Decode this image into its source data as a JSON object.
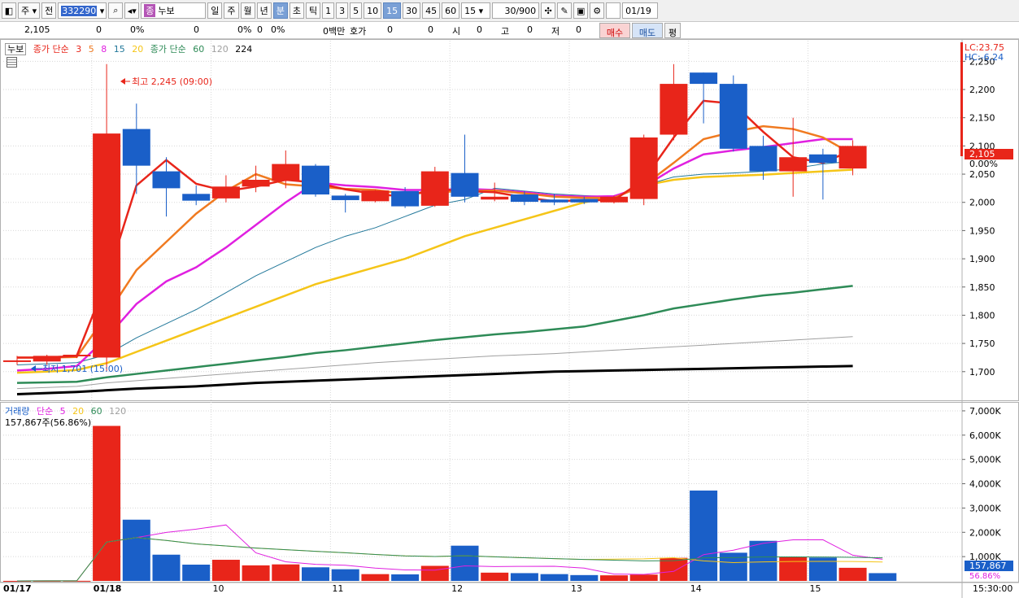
{
  "toolbar": {
    "market": "주",
    "prev": "전",
    "code": "332290",
    "name_badge": "종",
    "name": "누보",
    "periods": [
      "일",
      "주",
      "월",
      "년",
      "분",
      "초",
      "틱"
    ],
    "selected_period": "분",
    "intervals": [
      "1",
      "3",
      "5",
      "10",
      "15",
      "30",
      "45",
      "60"
    ],
    "selected_interval": "15",
    "interval_value": "15",
    "count": "30/900",
    "date": "01/19"
  },
  "quote": {
    "price": "2,105",
    "change": "0",
    "rate": "0%",
    "v1": "0",
    "v2": "0%",
    "v3": "0",
    "v4": "0%",
    "amount": "0백만",
    "hoga_label": "호가",
    "hoga1": "0",
    "hoga2": "0",
    "si_label": "시",
    "si": "0",
    "go_label": "고",
    "go": "0",
    "jeo_label": "저",
    "jeo": "0",
    "buy": "매수",
    "sell": "매도",
    "avg": "평"
  },
  "price_panel": {
    "name": "누보",
    "legend1": "종가 단순",
    "ma_short": [
      "3",
      "5",
      "8",
      "15",
      "20"
    ],
    "legend2": "종가 단순",
    "ma_long": [
      "60",
      "120",
      "224"
    ],
    "lc": "LC:23.75",
    "hc": "HC:-6.24",
    "high_label": "최고 2,245 (09:00)",
    "low_label": "최저 1,701 (15:00)",
    "current_price_tag": "2,105",
    "zero_pct": "0.00%"
  },
  "volume_panel": {
    "legend": "거래량",
    "legend2": "단순",
    "ma": [
      "5",
      "20",
      "60",
      "120"
    ],
    "info": "157,867주(56.86%)",
    "current_tag": "157,867",
    "pct_tag": "56.86%"
  },
  "x_axis": {
    "labels": [
      "01/17",
      "01/18",
      "10",
      "11",
      "12",
      "13",
      "14",
      "15"
    ],
    "end_time": "15:30:00"
  },
  "colors": {
    "up": "#e8251a",
    "down": "#1a5fc8",
    "ma3": "#e8251a",
    "ma5": "#f07a20",
    "ma8": "#e020e0",
    "ma15": "#22789a",
    "ma20": "#f5c518",
    "ma60": "#2e8b57",
    "ma120": "#a0a0a0",
    "ma224": "#000000"
  },
  "chart_data": {
    "type": "candlestick",
    "price_axis": [
      2250,
      2200,
      2150,
      2100,
      2050,
      2000,
      1950,
      1900,
      1850,
      1800,
      1750,
      1700
    ],
    "volume_axis": [
      "7,000K",
      "6,000K",
      "5,000K",
      "4,000K",
      "3,000K",
      "2,000K",
      "1,000K"
    ],
    "candles": [
      {
        "o": 1720,
        "h": 1728,
        "l": 1712,
        "c": 1720
      },
      {
        "o": 1718,
        "h": 1730,
        "l": 1712,
        "c": 1728
      },
      {
        "o": 1728,
        "h": 1732,
        "l": 1724,
        "c": 1730
      },
      {
        "o": 1725,
        "h": 2245,
        "l": 1701,
        "c": 2122
      },
      {
        "o": 2130,
        "h": 2175,
        "l": 2015,
        "c": 2065
      },
      {
        "o": 2055,
        "h": 2080,
        "l": 1975,
        "c": 2025
      },
      {
        "o": 2015,
        "h": 2030,
        "l": 1995,
        "c": 2003
      },
      {
        "o": 2007,
        "h": 2048,
        "l": 2000,
        "c": 2028
      },
      {
        "o": 2028,
        "h": 2065,
        "l": 2018,
        "c": 2040
      },
      {
        "o": 2038,
        "h": 2092,
        "l": 2025,
        "c": 2068
      },
      {
        "o": 2065,
        "h": 2068,
        "l": 2010,
        "c": 2014
      },
      {
        "o": 2012,
        "h": 2015,
        "l": 1982,
        "c": 2004
      },
      {
        "o": 2002,
        "h": 2022,
        "l": 2000,
        "c": 2021
      },
      {
        "o": 2020,
        "h": 2027,
        "l": 1990,
        "c": 1993
      },
      {
        "o": 1994,
        "h": 2063,
        "l": 1992,
        "c": 2055
      },
      {
        "o": 2052,
        "h": 2120,
        "l": 2000,
        "c": 2010
      },
      {
        "o": 2005,
        "h": 2035,
        "l": 2002,
        "c": 2010
      },
      {
        "o": 2014,
        "h": 2020,
        "l": 1995,
        "c": 2001
      },
      {
        "o": 2005,
        "h": 2015,
        "l": 1995,
        "c": 2000
      },
      {
        "o": 2006,
        "h": 2010,
        "l": 1997,
        "c": 2000
      },
      {
        "o": 2000,
        "h": 2012,
        "l": 1998,
        "c": 2010
      },
      {
        "o": 2006,
        "h": 2120,
        "l": 1995,
        "c": 2115
      },
      {
        "o": 2120,
        "h": 2245,
        "l": 2110,
        "c": 2210
      },
      {
        "o": 2230,
        "h": 2230,
        "l": 2140,
        "c": 2210
      },
      {
        "o": 2210,
        "h": 2225,
        "l": 2090,
        "c": 2095
      },
      {
        "o": 2100,
        "h": 2118,
        "l": 2040,
        "c": 2055
      },
      {
        "o": 2055,
        "h": 2150,
        "l": 2010,
        "c": 2080
      },
      {
        "o": 2085,
        "h": 2095,
        "l": 2005,
        "c": 2070
      },
      {
        "o": 2060,
        "h": 2110,
        "l": 2048,
        "c": 2100
      }
    ],
    "volumes": [
      2,
      3,
      5,
      6380,
      2520,
      1080,
      670,
      870,
      640,
      680,
      560,
      480,
      280,
      270,
      620,
      1450,
      340,
      320,
      280,
      240,
      230,
      260,
      950,
      3720,
      1160,
      1650,
      980,
      960,
      540,
      320
    ],
    "ma3": [
      1725,
      1725,
      1728,
      1862,
      2030,
      2075,
      2033,
      2020,
      2028,
      2040,
      2035,
      2023,
      2015,
      2010,
      2024,
      2020,
      2018,
      2009,
      2002,
      2004,
      2004,
      2040,
      2115,
      2180,
      2175,
      2125,
      2080,
      2070,
      2093
    ],
    "ma5": [
      1725,
      1725,
      1726,
      1800,
      1880,
      1930,
      1980,
      2020,
      2050,
      2032,
      2028,
      2024,
      2022,
      2015,
      2018,
      2020,
      2021,
      2016,
      2010,
      2008,
      2008,
      2030,
      2070,
      2112,
      2125,
      2135,
      2130,
      2115,
      2085
    ],
    "ma8": [
      1702,
      1705,
      1710,
      1760,
      1820,
      1860,
      1885,
      1920,
      1960,
      2000,
      2035,
      2030,
      2027,
      2022,
      2022,
      2024,
      2022,
      2018,
      2012,
      2010,
      2011,
      2028,
      2060,
      2085,
      2092,
      2098,
      2105,
      2112,
      2112
    ],
    "ma15": [
      1712,
      1714,
      1716,
      1730,
      1760,
      1785,
      1810,
      1840,
      1870,
      1895,
      1920,
      1940,
      1955,
      1975,
      1995,
      2005,
      2025,
      2020,
      2015,
      2012,
      2010,
      2030,
      2045,
      2050,
      2052,
      2055,
      2060,
      2068,
      2073
    ],
    "ma20": [
      1698,
      1700,
      1703,
      1715,
      1735,
      1755,
      1775,
      1795,
      1815,
      1835,
      1855,
      1870,
      1885,
      1900,
      1920,
      1940,
      1955,
      1970,
      1985,
      2000,
      2010,
      2030,
      2040,
      2045,
      2047,
      2049,
      2052,
      2055,
      2058
    ],
    "ma60": [
      1680,
      1681,
      1682,
      1690,
      1696,
      1702,
      1708,
      1714,
      1720,
      1726,
      1733,
      1738,
      1744,
      1750,
      1756,
      1761,
      1766,
      1770,
      1775,
      1780,
      1790,
      1800,
      1812,
      1820,
      1828,
      1835,
      1840,
      1846,
      1852
    ],
    "ma120": [
      1670,
      1672,
      1674,
      1680,
      1684,
      1688,
      1692,
      1696,
      1700,
      1704,
      1708,
      1712,
      1716,
      1719,
      1722,
      1725,
      1728,
      1730,
      1732,
      1735,
      1738,
      1741,
      1744,
      1747,
      1750,
      1753,
      1756,
      1759,
      1762
    ],
    "ma224": [
      1660,
      1662,
      1664,
      1667,
      1670,
      1672,
      1674,
      1677,
      1680,
      1682,
      1684,
      1686,
      1688,
      1690,
      1692,
      1694,
      1696,
      1698,
      1700,
      1701,
      1702,
      1703,
      1704,
      1705,
      1706,
      1707,
      1708,
      1709,
      1710
    ]
  }
}
